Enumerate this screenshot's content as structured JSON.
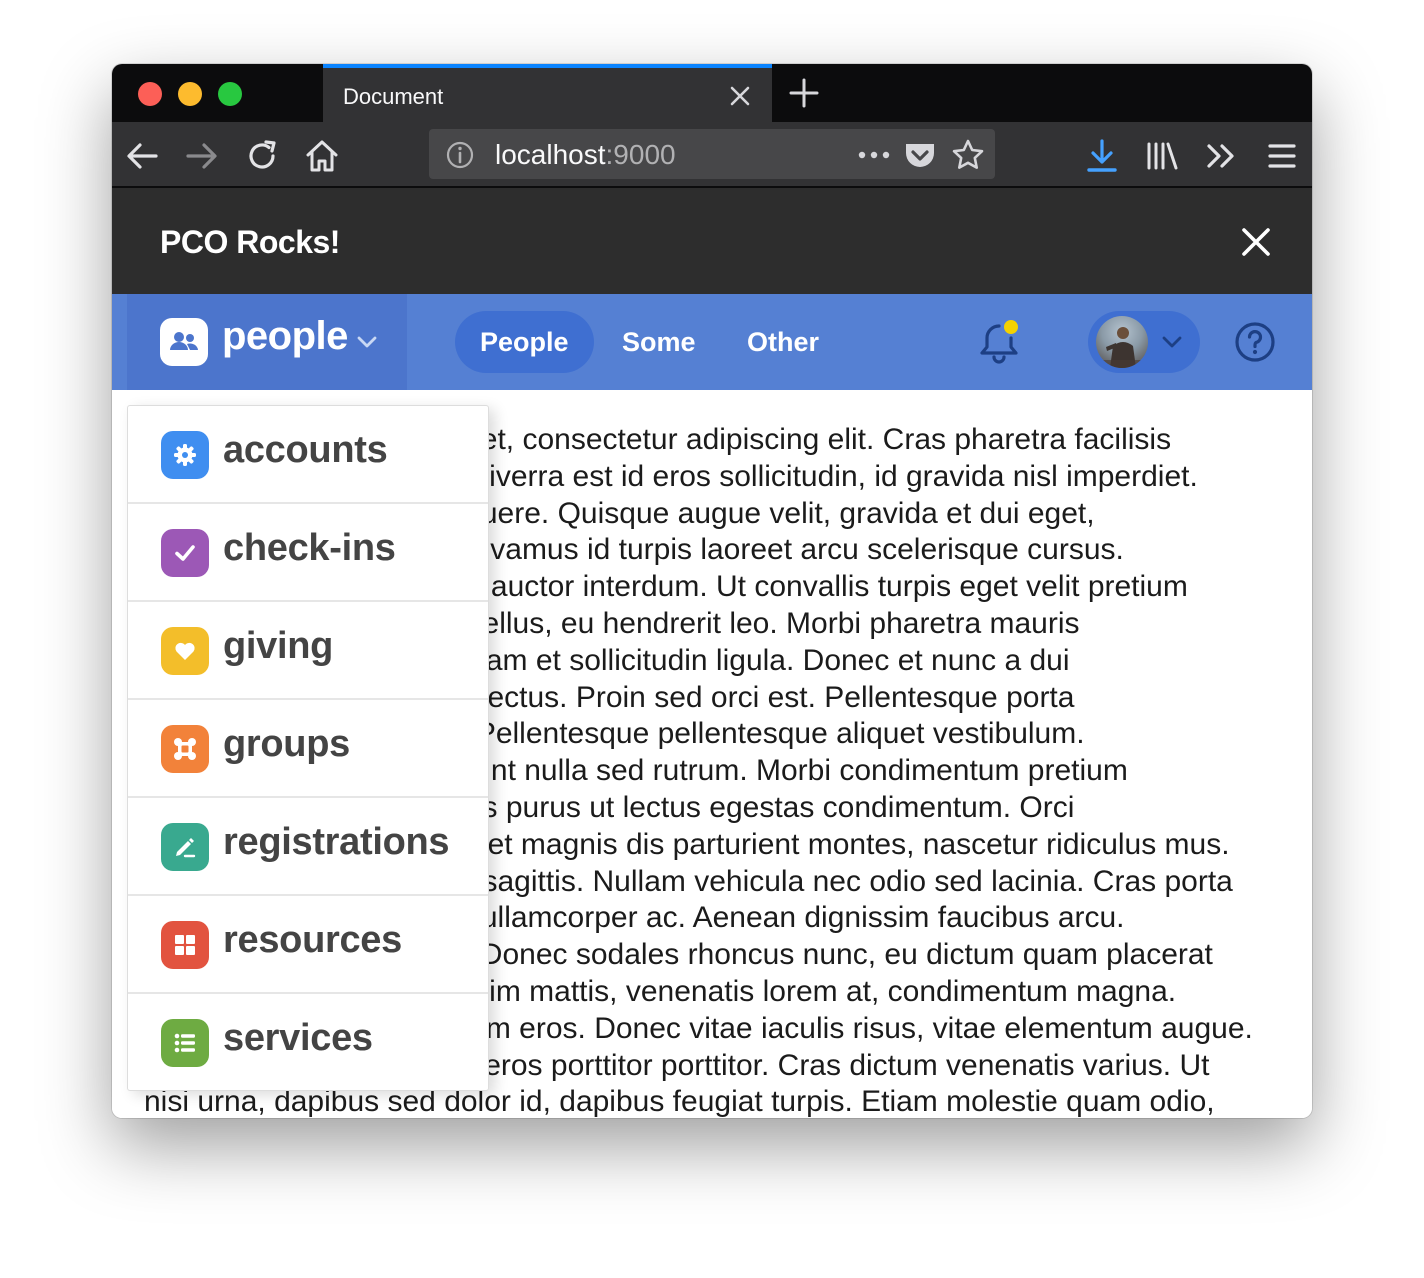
{
  "browser": {
    "tab_title": "Document",
    "url_host": "localhost",
    "url_port": ":9000"
  },
  "app": {
    "title": "PCO Rocks!"
  },
  "nav": {
    "product_name": "people",
    "tabs": [
      {
        "label": "People",
        "active": true
      },
      {
        "label": "Some",
        "active": false
      },
      {
        "label": "Other",
        "active": false
      }
    ],
    "notification_dot_color": "#f5d200"
  },
  "dropdown": {
    "items": [
      {
        "label": "accounts",
        "icon": "gear-icon",
        "color": "#3f8ef0"
      },
      {
        "label": "check-ins",
        "icon": "checkmark-icon",
        "color": "#9c58b6"
      },
      {
        "label": "giving",
        "icon": "heart-icon",
        "color": "#f3be2a"
      },
      {
        "label": "groups",
        "icon": "groups-icon",
        "color": "#f2823a"
      },
      {
        "label": "registrations",
        "icon": "pencil-icon",
        "color": "#39a98f"
      },
      {
        "label": "resources",
        "icon": "grid-icon",
        "color": "#e2533f"
      },
      {
        "label": "services",
        "icon": "list-icon",
        "color": "#6eab42"
      }
    ]
  },
  "content": {
    "lines": [
      "Lorem ipsum dolor sit amet, consectetur adipiscing elit. Cras pharetra facilisis",
      "mauris, ut blandit ut erat viverra est id eros sollicitudin, id gravida nisl imperdiet.",
      "Phasellus eu felis vel posuere. Quisque augue velit, gravida et dui eget,",
      "tincidunt semper lorem. Vivamus id turpis laoreet arcu scelerisque cursus.",
      "Suspendisse dui ligula, id auctor interdum. Ut convallis turpis eget velit pretium",
      "tempus. Integer volutpat tellus, eu hendrerit leo. Morbi pharetra mauris",
      "vitae cursus tempor. Aliquam et sollicitudin ligula. Donec et nunc a dui",
      "luctus, sed maximus sed lectus. Proin sed orci est. Pellentesque porta",
      "ipsum a ligula imperdiet. Pellentesque pellentesque aliquet vestibulum.",
      "Maecenas eleifend tincidunt nulla sed rutrum. Morbi condimentum pretium",
      "sollicitudin. Aliquam iaculis purus ut lectus egestas condimentum. Orci",
      "varius natoque penatibus et magnis dis parturient montes, nascetur ridiculus mus.",
      "Nam a justo quam. Nunc sagittis. Nullam vehicula nec odio sed lacinia. Cras porta",
      "sapien vel risus, ac nunc ullamcorper ac. Aenean dignissim faucibus arcu.",
      "Vestibulum ac lacinia mi. Donec sodales rhoncus nunc, eu dictum quam placerat",
      "at. Morbi lobortis, nunc enim mattis, venenatis lorem at, condimentum magna.",
      "Sed a tellus sit amet dictum eros. Donec vitae iaculis risus, vitae elementum augue.",
      "Quisque semper, nunc id eros porttitor porttitor. Cras dictum venenatis varius. Ut",
      "nisi urna, dapibus sed dolor id, dapibus feugiat turpis. Etiam molestie quam odio,"
    ]
  }
}
